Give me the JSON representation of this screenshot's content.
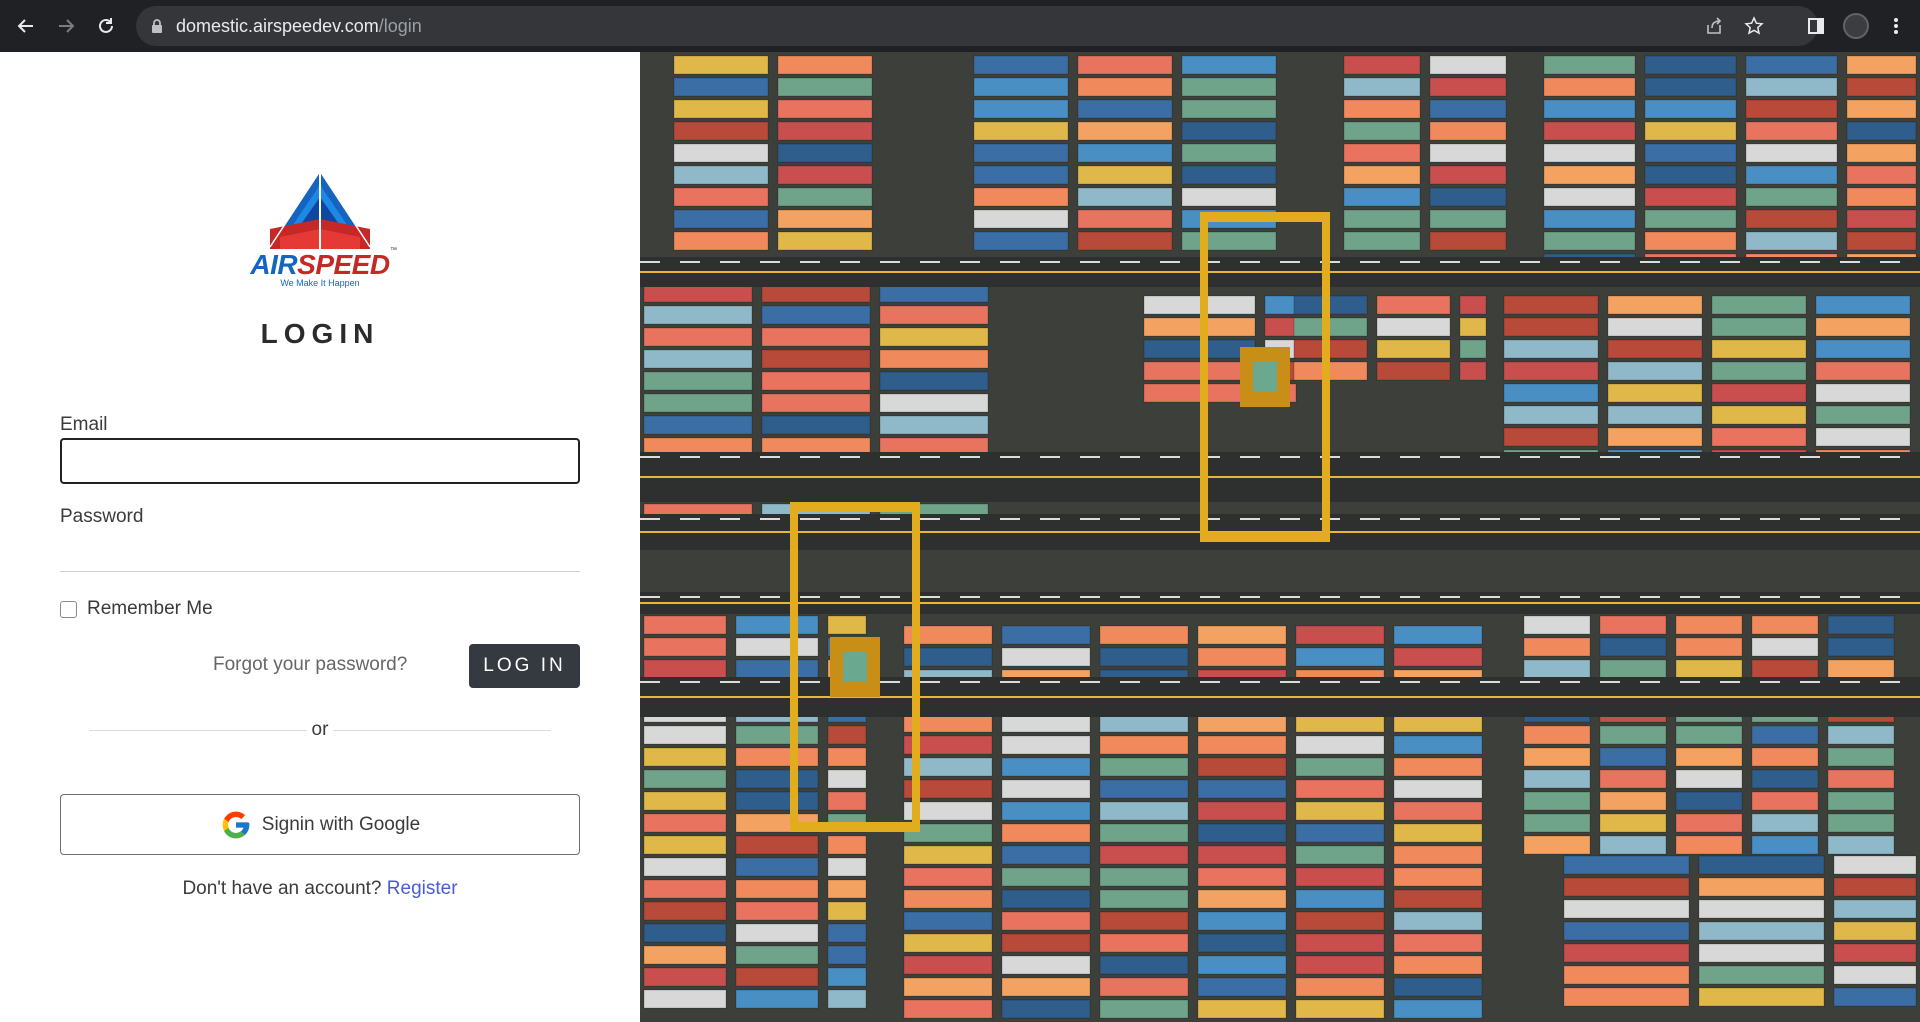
{
  "browser": {
    "url_host": "domestic.airspeedev.com",
    "url_path": "/login",
    "icons": [
      "back-icon",
      "forward-icon",
      "reload-icon",
      "lock-icon",
      "share-icon",
      "bookmark-star-icon",
      "side-panel-icon",
      "profile-avatar",
      "menu-kebab-icon"
    ]
  },
  "brand": {
    "name_part1": "AIR",
    "name_part2": "SPEED",
    "tm": "™",
    "tagline": "We Make It Happen",
    "colors": {
      "blue": "#1565c0",
      "red": "#c62828"
    }
  },
  "login": {
    "title": "LOGIN",
    "email_label": "Email",
    "email_value": "",
    "password_label": "Password",
    "password_value": "",
    "remember_label": "Remember Me",
    "remember_checked": false,
    "forgot_label": "Forgot your password?",
    "submit_label": "LOG IN",
    "divider_text": "or",
    "google_label": "Signin with Google",
    "signup_prompt": "Don't have an account?",
    "register_label": "Register"
  },
  "hero": {
    "description_icon": "container-port-aerial-photo",
    "colors": {
      "button_dark": "#343a40",
      "link": "#4a5bd4"
    }
  }
}
